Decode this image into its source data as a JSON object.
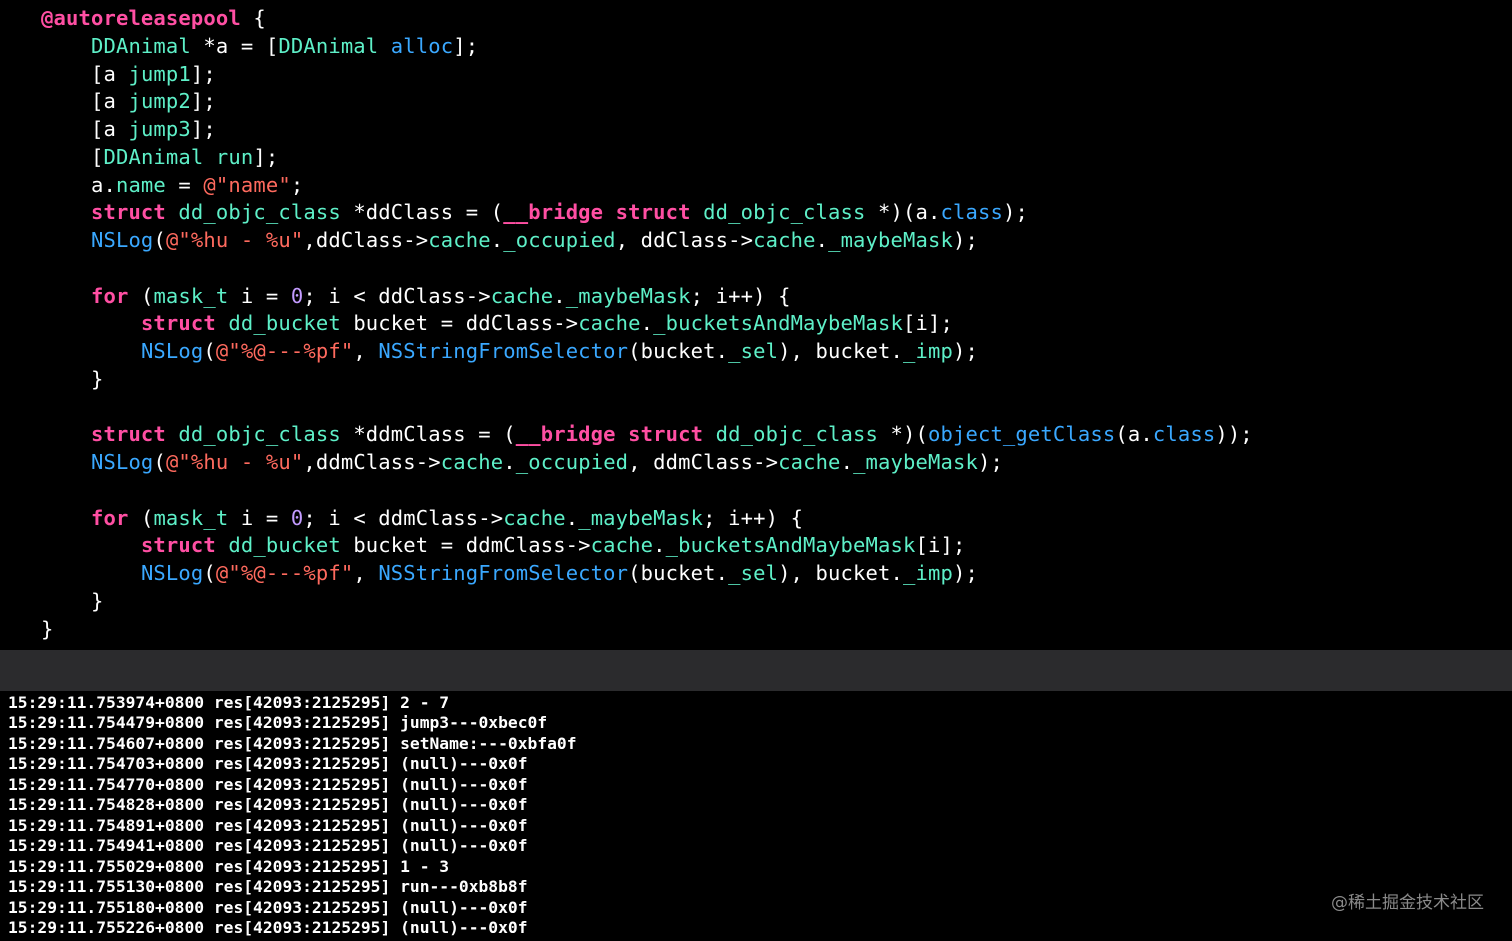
{
  "editor": {
    "lines": [
      [
        {
          "c": "kw",
          "t": "@autoreleasepool"
        },
        {
          "c": "plain",
          "t": " {"
        }
      ],
      [
        {
          "c": "plain",
          "t": "    "
        },
        {
          "c": "type",
          "t": "DDAnimal"
        },
        {
          "c": "plain",
          "t": " *a = ["
        },
        {
          "c": "type",
          "t": "DDAnimal"
        },
        {
          "c": "plain",
          "t": " "
        },
        {
          "c": "fn",
          "t": "alloc"
        },
        {
          "c": "plain",
          "t": "];"
        }
      ],
      [
        {
          "c": "plain",
          "t": "    [a "
        },
        {
          "c": "mem",
          "t": "jump1"
        },
        {
          "c": "plain",
          "t": "];"
        }
      ],
      [
        {
          "c": "plain",
          "t": "    [a "
        },
        {
          "c": "mem",
          "t": "jump2"
        },
        {
          "c": "plain",
          "t": "];"
        }
      ],
      [
        {
          "c": "plain",
          "t": "    [a "
        },
        {
          "c": "mem",
          "t": "jump3"
        },
        {
          "c": "plain",
          "t": "];"
        }
      ],
      [
        {
          "c": "plain",
          "t": "    ["
        },
        {
          "c": "type",
          "t": "DDAnimal"
        },
        {
          "c": "plain",
          "t": " "
        },
        {
          "c": "mem",
          "t": "run"
        },
        {
          "c": "plain",
          "t": "];"
        }
      ],
      [
        {
          "c": "plain",
          "t": "    a."
        },
        {
          "c": "mem",
          "t": "name"
        },
        {
          "c": "plain",
          "t": " = "
        },
        {
          "c": "str",
          "t": "@\"name\""
        },
        {
          "c": "plain",
          "t": ";"
        }
      ],
      [
        {
          "c": "plain",
          "t": "    "
        },
        {
          "c": "kw",
          "t": "struct"
        },
        {
          "c": "plain",
          "t": " "
        },
        {
          "c": "type",
          "t": "dd_objc_class"
        },
        {
          "c": "plain",
          "t": " *ddClass = ("
        },
        {
          "c": "kw",
          "t": "__bridge"
        },
        {
          "c": "plain",
          "t": " "
        },
        {
          "c": "kw",
          "t": "struct"
        },
        {
          "c": "plain",
          "t": " "
        },
        {
          "c": "type",
          "t": "dd_objc_class"
        },
        {
          "c": "plain",
          "t": " *)(a."
        },
        {
          "c": "fn",
          "t": "class"
        },
        {
          "c": "plain",
          "t": ");"
        }
      ],
      [
        {
          "c": "plain",
          "t": "    "
        },
        {
          "c": "fn",
          "t": "NSLog"
        },
        {
          "c": "plain",
          "t": "("
        },
        {
          "c": "str",
          "t": "@\"%hu - %u\""
        },
        {
          "c": "plain",
          "t": ",ddClass->"
        },
        {
          "c": "mem",
          "t": "cache"
        },
        {
          "c": "plain",
          "t": "."
        },
        {
          "c": "mem",
          "t": "_occupied"
        },
        {
          "c": "plain",
          "t": ", ddClass->"
        },
        {
          "c": "mem",
          "t": "cache"
        },
        {
          "c": "plain",
          "t": "."
        },
        {
          "c": "mem",
          "t": "_maybeMask"
        },
        {
          "c": "plain",
          "t": ");"
        }
      ],
      [],
      [
        {
          "c": "plain",
          "t": "    "
        },
        {
          "c": "kw",
          "t": "for"
        },
        {
          "c": "plain",
          "t": " ("
        },
        {
          "c": "type",
          "t": "mask_t"
        },
        {
          "c": "plain",
          "t": " i = "
        },
        {
          "c": "num",
          "t": "0"
        },
        {
          "c": "plain",
          "t": "; i < ddClass->"
        },
        {
          "c": "mem",
          "t": "cache"
        },
        {
          "c": "plain",
          "t": "."
        },
        {
          "c": "mem",
          "t": "_maybeMask"
        },
        {
          "c": "plain",
          "t": "; i++) {"
        }
      ],
      [
        {
          "c": "plain",
          "t": "        "
        },
        {
          "c": "kw",
          "t": "struct"
        },
        {
          "c": "plain",
          "t": " "
        },
        {
          "c": "type",
          "t": "dd_bucket"
        },
        {
          "c": "plain",
          "t": " bucket = ddClass->"
        },
        {
          "c": "mem",
          "t": "cache"
        },
        {
          "c": "plain",
          "t": "."
        },
        {
          "c": "mem",
          "t": "_bucketsAndMaybeMask"
        },
        {
          "c": "plain",
          "t": "[i];"
        }
      ],
      [
        {
          "c": "plain",
          "t": "        "
        },
        {
          "c": "fn",
          "t": "NSLog"
        },
        {
          "c": "plain",
          "t": "("
        },
        {
          "c": "str",
          "t": "@\"%@---%pf\""
        },
        {
          "c": "plain",
          "t": ", "
        },
        {
          "c": "fn",
          "t": "NSStringFromSelector"
        },
        {
          "c": "plain",
          "t": "(bucket."
        },
        {
          "c": "mem",
          "t": "_sel"
        },
        {
          "c": "plain",
          "t": "), bucket."
        },
        {
          "c": "mem",
          "t": "_imp"
        },
        {
          "c": "plain",
          "t": ");"
        }
      ],
      [
        {
          "c": "plain",
          "t": "    }"
        }
      ],
      [],
      [
        {
          "c": "plain",
          "t": "    "
        },
        {
          "c": "kw",
          "t": "struct"
        },
        {
          "c": "plain",
          "t": " "
        },
        {
          "c": "type",
          "t": "dd_objc_class"
        },
        {
          "c": "plain",
          "t": " *ddmClass = ("
        },
        {
          "c": "kw",
          "t": "__bridge"
        },
        {
          "c": "plain",
          "t": " "
        },
        {
          "c": "kw",
          "t": "struct"
        },
        {
          "c": "plain",
          "t": " "
        },
        {
          "c": "type",
          "t": "dd_objc_class"
        },
        {
          "c": "plain",
          "t": " *)("
        },
        {
          "c": "fn",
          "t": "object_getClass"
        },
        {
          "c": "plain",
          "t": "(a."
        },
        {
          "c": "fn",
          "t": "class"
        },
        {
          "c": "plain",
          "t": "));"
        }
      ],
      [
        {
          "c": "plain",
          "t": "    "
        },
        {
          "c": "fn",
          "t": "NSLog"
        },
        {
          "c": "plain",
          "t": "("
        },
        {
          "c": "str",
          "t": "@\"%hu - %u\""
        },
        {
          "c": "plain",
          "t": ",ddmClass->"
        },
        {
          "c": "mem",
          "t": "cache"
        },
        {
          "c": "plain",
          "t": "."
        },
        {
          "c": "mem",
          "t": "_occupied"
        },
        {
          "c": "plain",
          "t": ", ddmClass->"
        },
        {
          "c": "mem",
          "t": "cache"
        },
        {
          "c": "plain",
          "t": "."
        },
        {
          "c": "mem",
          "t": "_maybeMask"
        },
        {
          "c": "plain",
          "t": ");"
        }
      ],
      [],
      [
        {
          "c": "plain",
          "t": "    "
        },
        {
          "c": "kw",
          "t": "for"
        },
        {
          "c": "plain",
          "t": " ("
        },
        {
          "c": "type",
          "t": "mask_t"
        },
        {
          "c": "plain",
          "t": " i = "
        },
        {
          "c": "num",
          "t": "0"
        },
        {
          "c": "plain",
          "t": "; i < ddmClass->"
        },
        {
          "c": "mem",
          "t": "cache"
        },
        {
          "c": "plain",
          "t": "."
        },
        {
          "c": "mem",
          "t": "_maybeMask"
        },
        {
          "c": "plain",
          "t": "; i++) {"
        }
      ],
      [
        {
          "c": "plain",
          "t": "        "
        },
        {
          "c": "kw",
          "t": "struct"
        },
        {
          "c": "plain",
          "t": " "
        },
        {
          "c": "type",
          "t": "dd_bucket"
        },
        {
          "c": "plain",
          "t": " bucket = ddmClass->"
        },
        {
          "c": "mem",
          "t": "cache"
        },
        {
          "c": "plain",
          "t": "."
        },
        {
          "c": "mem",
          "t": "_bucketsAndMaybeMask"
        },
        {
          "c": "plain",
          "t": "[i];"
        }
      ],
      [
        {
          "c": "plain",
          "t": "        "
        },
        {
          "c": "fn",
          "t": "NSLog"
        },
        {
          "c": "plain",
          "t": "("
        },
        {
          "c": "str",
          "t": "@\"%@---%pf\""
        },
        {
          "c": "plain",
          "t": ", "
        },
        {
          "c": "fn",
          "t": "NSStringFromSelector"
        },
        {
          "c": "plain",
          "t": "(bucket."
        },
        {
          "c": "mem",
          "t": "_sel"
        },
        {
          "c": "plain",
          "t": "), bucket."
        },
        {
          "c": "mem",
          "t": "_imp"
        },
        {
          "c": "plain",
          "t": ");"
        }
      ],
      [
        {
          "c": "plain",
          "t": "    }"
        }
      ],
      [
        {
          "c": "plain",
          "t": "}"
        }
      ]
    ]
  },
  "console": {
    "lines": [
      "15:29:11.753974+0800 res[42093:2125295] 2 - 7",
      "15:29:11.754479+0800 res[42093:2125295] jump3---0xbec0f",
      "15:29:11.754607+0800 res[42093:2125295] setName:---0xbfa0f",
      "15:29:11.754703+0800 res[42093:2125295] (null)---0x0f",
      "15:29:11.754770+0800 res[42093:2125295] (null)---0x0f",
      "15:29:11.754828+0800 res[42093:2125295] (null)---0x0f",
      "15:29:11.754891+0800 res[42093:2125295] (null)---0x0f",
      "15:29:11.754941+0800 res[42093:2125295] (null)---0x0f",
      "15:29:11.755029+0800 res[42093:2125295] 1 - 3",
      "15:29:11.755130+0800 res[42093:2125295] run---0xb8b8f",
      "15:29:11.755180+0800 res[42093:2125295] (null)---0x0f",
      "15:29:11.755226+0800 res[42093:2125295] (null)---0x0f"
    ]
  },
  "watermark": "@稀土掘金技术社区",
  "colors": {
    "keyword": "#ff4fa3",
    "type": "#5ef0c8",
    "function": "#3aa8ff",
    "member": "#5ef0c8",
    "string": "#ff6a5e",
    "number": "#c39bff",
    "text": "#ffffff",
    "background": "#000000",
    "divider": "#2b2b2d"
  }
}
